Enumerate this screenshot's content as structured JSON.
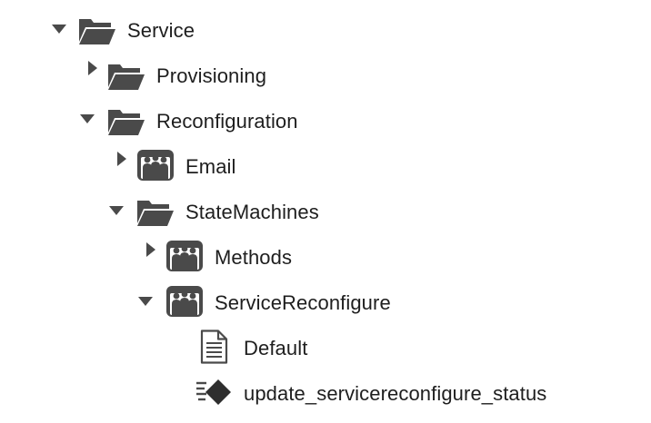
{
  "tree": {
    "nodes": [
      {
        "id": "service",
        "label": "Service",
        "icon": "folder-open-icon",
        "expanded": true,
        "has_toggle": true
      },
      {
        "id": "provisioning",
        "label": "Provisioning",
        "icon": "folder-open-icon",
        "expanded": false,
        "has_toggle": true
      },
      {
        "id": "reconfiguration",
        "label": "Reconfiguration",
        "icon": "folder-open-icon",
        "expanded": true,
        "has_toggle": true
      },
      {
        "id": "email",
        "label": "Email",
        "icon": "class-icon",
        "expanded": false,
        "has_toggle": true
      },
      {
        "id": "statemachines",
        "label": "StateMachines",
        "icon": "folder-open-icon",
        "expanded": true,
        "has_toggle": true
      },
      {
        "id": "methods",
        "label": "Methods",
        "icon": "class-icon",
        "expanded": false,
        "has_toggle": true
      },
      {
        "id": "servicereconfigure",
        "label": "ServiceReconfigure",
        "icon": "class-icon",
        "expanded": true,
        "has_toggle": true
      },
      {
        "id": "default",
        "label": "Default",
        "icon": "document-icon",
        "has_toggle": false
      },
      {
        "id": "update_status",
        "label": "update_servicereconfigure_status",
        "icon": "method-icon",
        "has_toggle": false
      }
    ]
  },
  "colors": {
    "icon": "#4a4a4a",
    "toggle": "#4a4a4a",
    "text": "#1e1e1e"
  }
}
